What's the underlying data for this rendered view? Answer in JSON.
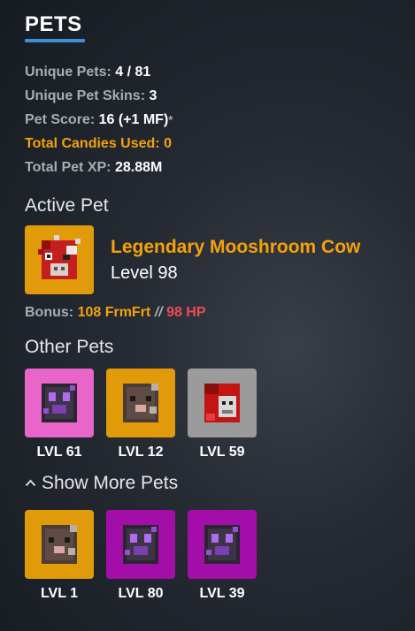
{
  "header": {
    "title": "PETS"
  },
  "stats": [
    {
      "label": "Unique Pets:",
      "value": "4 / 81",
      "style": "normal"
    },
    {
      "label": "Unique Pet Skins:",
      "value": "3",
      "style": "normal"
    },
    {
      "label": "Pet Score:",
      "value": "16 (+1 MF)",
      "suffix": "*",
      "style": "normal"
    },
    {
      "label": "Total Candies Used:",
      "value": "0",
      "style": "orange"
    },
    {
      "label": "Total Pet XP:",
      "value": "28.88M",
      "style": "normal"
    }
  ],
  "active_pet": {
    "heading": "Active Pet",
    "name": "Legendary Mooshroom Cow",
    "level": "Level 98",
    "tile_color": "#e19a0a",
    "icon": "mooshroom-cow-head-icon",
    "bonus_label": "Bonus:",
    "bonus_farming": "108 FrmFrt",
    "bonus_sep": "//",
    "bonus_hp": "98 HP"
  },
  "other_pets": {
    "heading": "Other Pets",
    "items": [
      {
        "level": "LVL 61",
        "tile_color": "#e866c9",
        "icon": "enderman-head-icon"
      },
      {
        "level": "LVL 12",
        "tile_color": "#e19a0a",
        "icon": "rat-head-icon"
      },
      {
        "level": "LVL 59",
        "tile_color": "#9b9b9b",
        "icon": "red-hooded-head-icon"
      }
    ]
  },
  "show_more": {
    "label": "Show More Pets",
    "icon": "chevron-up-icon"
  },
  "more_pets": {
    "items": [
      {
        "level": "LVL 1",
        "tile_color": "#e19a0a",
        "icon": "rat-head-icon"
      },
      {
        "level": "LVL 80",
        "tile_color": "#a30da8",
        "icon": "enderman-head-icon"
      },
      {
        "level": "LVL 39",
        "tile_color": "#a30da8",
        "icon": "enderman-head-icon"
      }
    ]
  }
}
